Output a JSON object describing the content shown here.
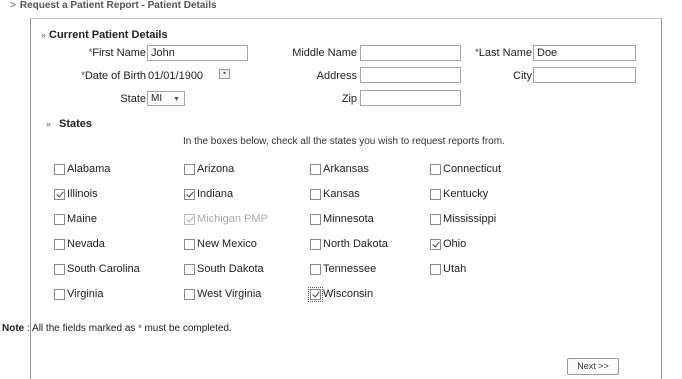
{
  "breadcrumb": "Request a  Patient Report - Patient Details",
  "sections": {
    "patient_title": "Current Patient Details",
    "states_title": "States"
  },
  "fields": {
    "first_name": {
      "label": "First Name",
      "value": "John",
      "required": true
    },
    "middle_name": {
      "label": "Middle Name",
      "value": "",
      "required": false
    },
    "last_name": {
      "label": "Last Name",
      "value": "Doe",
      "required": true
    },
    "dob": {
      "label": "Date of  Birth",
      "value": "01/01/1900",
      "required": true
    },
    "address": {
      "label": "Address",
      "value": ""
    },
    "city": {
      "label": "City",
      "value": ""
    },
    "state": {
      "label": "State",
      "value": "MI"
    },
    "zip": {
      "label": "Zip",
      "value": ""
    }
  },
  "required_marker": "*",
  "states_instruction": "In the boxes below, check all the states you wish to request reports from.",
  "states": [
    {
      "name": "Alabama",
      "checked": false,
      "disabled": false
    },
    {
      "name": "Arizona",
      "checked": false,
      "disabled": false
    },
    {
      "name": "Arkansas",
      "checked": false,
      "disabled": false
    },
    {
      "name": "Connecticut",
      "checked": false,
      "disabled": false
    },
    {
      "name": "Illinois",
      "checked": true,
      "disabled": false
    },
    {
      "name": "Indiana",
      "checked": true,
      "disabled": false
    },
    {
      "name": "Kansas",
      "checked": false,
      "disabled": false
    },
    {
      "name": "Kentucky",
      "checked": false,
      "disabled": false
    },
    {
      "name": "Maine",
      "checked": false,
      "disabled": false
    },
    {
      "name": "Michigan PMP",
      "checked": true,
      "disabled": true
    },
    {
      "name": "Minnesota",
      "checked": false,
      "disabled": false
    },
    {
      "name": "Mississippi",
      "checked": false,
      "disabled": false
    },
    {
      "name": "Nevada",
      "checked": false,
      "disabled": false
    },
    {
      "name": "New Mexico",
      "checked": false,
      "disabled": false
    },
    {
      "name": "North Dakota",
      "checked": false,
      "disabled": false
    },
    {
      "name": "Ohio",
      "checked": true,
      "disabled": false
    },
    {
      "name": "South Carolina",
      "checked": false,
      "disabled": false
    },
    {
      "name": "South Dakota",
      "checked": false,
      "disabled": false
    },
    {
      "name": "Tennessee",
      "checked": false,
      "disabled": false
    },
    {
      "name": "Utah",
      "checked": false,
      "disabled": false
    },
    {
      "name": "Virginia",
      "checked": false,
      "disabled": false
    },
    {
      "name": "West Virginia",
      "checked": false,
      "disabled": false
    },
    {
      "name": "Wisconsin",
      "checked": true,
      "disabled": false,
      "focused": true
    }
  ],
  "note": {
    "prefix": "Note",
    "text": " : All the fields marked as ",
    "marker": "*",
    "suffix": "  must be completed."
  },
  "next_label": "Next >>"
}
